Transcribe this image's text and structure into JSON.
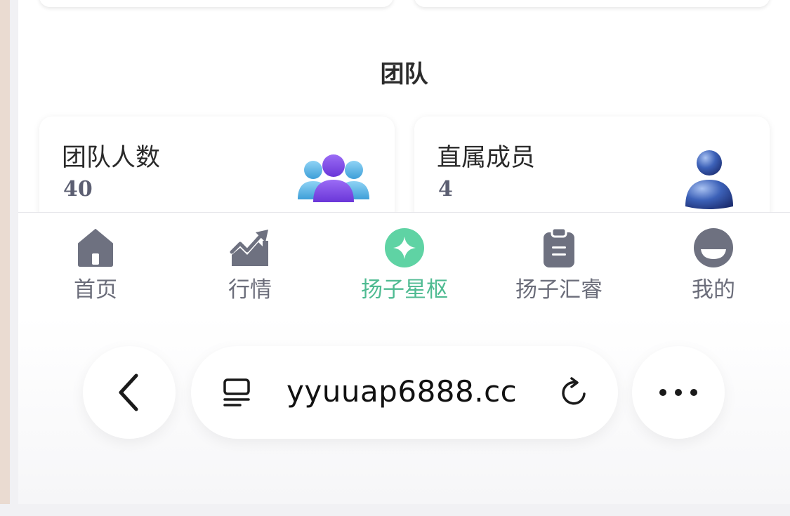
{
  "section": {
    "title": "团队"
  },
  "cards": [
    {
      "label": "团队人数",
      "value": "40",
      "icon": "team-group-icon"
    },
    {
      "label": "直属成员",
      "value": "4",
      "icon": "single-user-icon"
    }
  ],
  "tabbar": {
    "tabs": [
      {
        "label": "首页",
        "icon": "home-icon"
      },
      {
        "label": "行情",
        "icon": "trend-chart-icon"
      },
      {
        "label": "扬子星枢",
        "icon": "star-diamond-icon",
        "active": true
      },
      {
        "label": "扬子汇睿",
        "icon": "clipboard-icon"
      },
      {
        "label": "我的",
        "icon": "profile-half-circle-icon"
      }
    ],
    "active_color": "#4fbb92",
    "inactive_color": "#6b6d7a"
  },
  "browser": {
    "url": "yyuuap6888.cc"
  }
}
